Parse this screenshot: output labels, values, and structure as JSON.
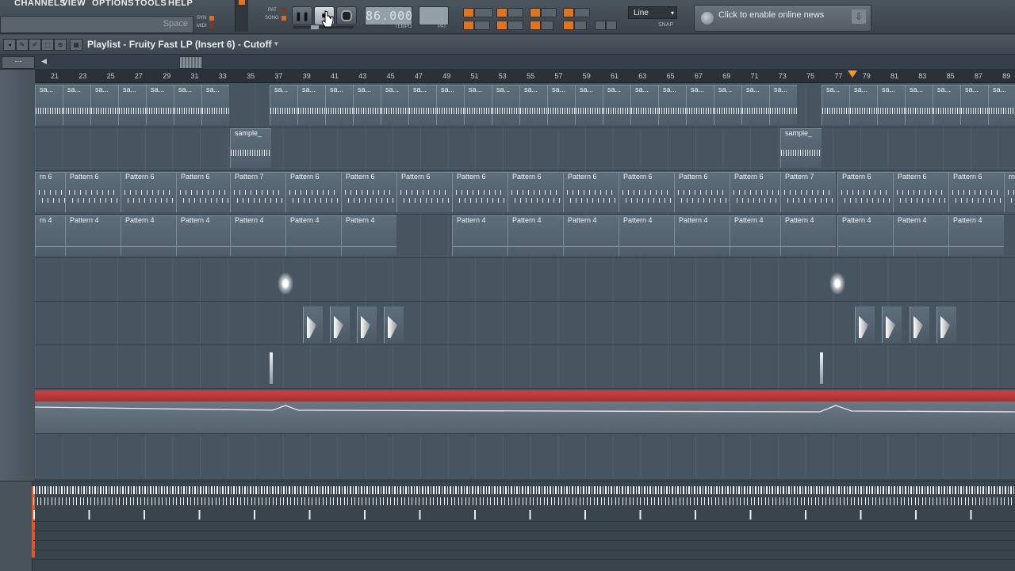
{
  "menu": [
    "CHANNELS",
    "VIEW",
    "OPTIONS",
    "TOOLS",
    "HELP"
  ],
  "hint": {
    "text": "Space"
  },
  "transport": {
    "pat_label": "PAT",
    "song_label": "SONG",
    "syn_label": "SYN",
    "midi_label": "MIDI",
    "tempo_value": "86.000",
    "tempo_label": "TEMPO",
    "pattern_label": "PAT"
  },
  "snap": {
    "value": "Line",
    "label": "SNAP"
  },
  "news": {
    "text": "Click to enable online news"
  },
  "playlist": {
    "title": "Playlist - Fruity Fast LP (Insert 6) - Cutoff",
    "tool_pill": "-·-"
  },
  "ruler": {
    "ticks": [
      "21",
      "23",
      "25",
      "27",
      "29",
      "31",
      "33",
      "35",
      "37",
      "39",
      "41",
      "43",
      "45",
      "47",
      "49",
      "51",
      "53",
      "55",
      "57",
      "59",
      "61",
      "63",
      "65",
      "67",
      "69",
      "71",
      "73",
      "75",
      "77",
      "79",
      "81",
      "83",
      "85",
      "87",
      "89"
    ]
  },
  "tracks": {
    "sample_label": "sa...",
    "sample_short": "sample_",
    "pattern6": "Pattern 6",
    "pattern7": "Pattern 7",
    "pattern4": "Pattern 4",
    "pattern6_cut": "rn 6",
    "pattern4_cut": "rn 4"
  },
  "colors": {
    "accent": "#e2741e",
    "automation": "#c94343",
    "background": "#475561"
  }
}
